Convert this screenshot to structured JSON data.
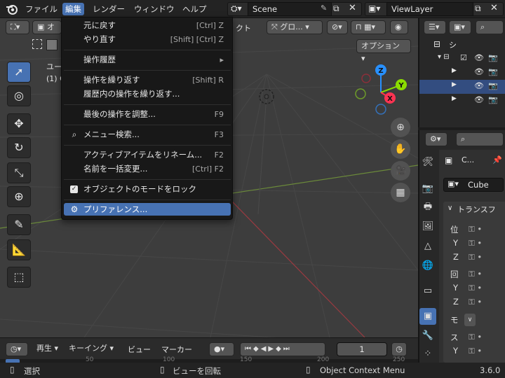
{
  "menubar": {
    "items": [
      "ファイル",
      "編集",
      "レンダー",
      "ウィンドウ",
      "ヘルプ"
    ],
    "active_index": 1
  },
  "scene": {
    "name": "Scene"
  },
  "view_layer": {
    "name": "ViewLayer"
  },
  "viewport_header": {
    "transform_orientation": "グロ...",
    "object_mode_fragment": "オ",
    "add_fragment": "クト",
    "options_label": "オプション"
  },
  "viewport_overlay": {
    "line1": "ユー",
    "line2": "(1) C"
  },
  "gizmo": {
    "x_label": "X",
    "y_label": "Y",
    "z_label": "Z"
  },
  "edit_menu": {
    "items": [
      {
        "label": "元に戻す",
        "shortcut": "[Ctrl] Z"
      },
      {
        "label": "やり直す",
        "shortcut": "[Shift] [Ctrl] Z"
      },
      {
        "label": "操作履歴",
        "shortcut": "▸"
      },
      {
        "label": "操作を繰り返す",
        "shortcut": "[Shift] R"
      },
      {
        "label": "履歴内の操作を繰り返す...",
        "shortcut": ""
      },
      {
        "label": "最後の操作を調整...",
        "shortcut": "F9"
      },
      {
        "label": "メニュー検索...",
        "shortcut": "F3"
      },
      {
        "label": "アクティブアイテムをリネーム...",
        "shortcut": "F2"
      },
      {
        "label": "名前を一括変更...",
        "shortcut": "[Ctrl] F2"
      },
      {
        "label": "オブジェクトのモードをロック",
        "shortcut": ""
      },
      {
        "label": "プリファレンス...",
        "shortcut": ""
      }
    ],
    "highlighted_index": 10,
    "lock_object_modes_checked": true
  },
  "timeline": {
    "playback_label": "再生",
    "keying_label": "キーイング",
    "view_label": "ビュー",
    "marker_label": "マーカー",
    "current_frame": "1",
    "ruler_ticks": [
      "50",
      "100",
      "150",
      "200",
      "250"
    ]
  },
  "outliner": {
    "root_label": "シ"
  },
  "properties": {
    "object_name_short": "C...",
    "object_name": "Cube",
    "panel_title": "トランスフ",
    "location_label": "位",
    "rotation_label": "回",
    "scale_label": "ス",
    "mode_label": "モ",
    "axis_y": "Y",
    "axis_z": "Z"
  },
  "statusbar": {
    "select_label": "選択",
    "rotate_view_label": "ビューを回転",
    "context_menu_label": "Object Context Menu",
    "version": "3.6.0"
  },
  "colors": {
    "accent": "#4772b3",
    "x_axis": "#ff3352",
    "y_axis": "#8bdc00",
    "z_axis": "#2890ff"
  }
}
